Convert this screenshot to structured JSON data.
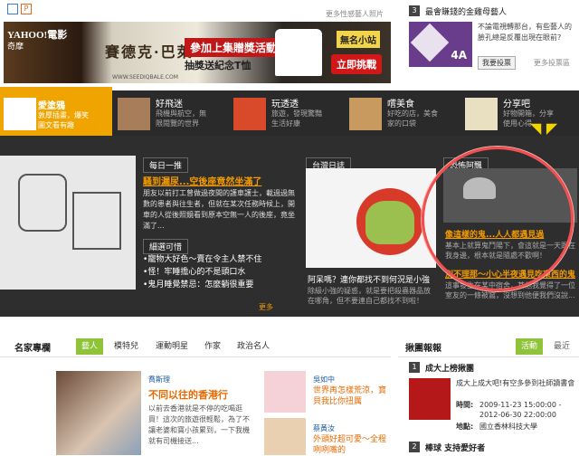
{
  "top": {
    "left_label": "P",
    "more_link": "更多性感藝人照片",
    "rank_number": "3",
    "rank_title": "最會賺錢的金雞母藝人"
  },
  "ad": {
    "brand": "YAHOO!電影",
    "brand_sub": "奇摩",
    "movie_title": "賽德克·巴萊",
    "headline": "參加上集贈獎活動",
    "subline": "抽獎送紀念T恤",
    "shop_badge": "無名小站",
    "cta": "立即挑戰",
    "fine_print": "WWW.SEEDIQBALE.COM"
  },
  "sidebar_top": {
    "logo_text": "4A",
    "desc": "不論電視轉那台，有些藝人的臉孔總是反覆出現在眼前?",
    "vote_button": "我要投票",
    "more": "更多投票區"
  },
  "nav": [
    {
      "title": "愛塗鴉",
      "sub": "敦厚插畫，爆笑圖文看有趣"
    },
    {
      "title": "好飛迷",
      "sub": "飛機與航空，無限閱覽的世界"
    },
    {
      "title": "玩透透",
      "sub": "旅遊，發現驚豔生活好康"
    },
    {
      "title": "嚐美食",
      "sub": "好吃的店，美食家的口袋"
    },
    {
      "title": "分享吧",
      "sub": "好物開箱，分享使用心得"
    }
  ],
  "main": {
    "daily_tag": "每日一推",
    "daily_headline": "騷到漏尿...空後座竟然坐滿了",
    "daily_body": "朋友以前打工曾做過夜間的護車護士，載過過無數的患者與往生者，但就在某次任務時候上，開車的人從後照鏡看到原本空無一人的後座，竟坐滿了...",
    "more_tag": "細選可惜",
    "list": [
      "寵物大好色～賣在令主人禁不住",
      "怪！牢睡擔心的不是頭口水",
      "鬼月睡覺禁忌：怎麼躺很重要"
    ],
    "more": "更多",
    "diary_tag": "台灣日誌",
    "diary_caption": "阿呆嗎？連你都找不到何況是小強",
    "diary_body": "除級小強的疑惑，就是要把殺蟲器品放在哪角，但不要連自己都找不到啦！",
    "scary_tag": "恐怖阿飄",
    "scary_headline": "像這樣的鬼...人人都遇見過",
    "scary_body": "基本上就算鬼鬥陽下，會這就是一天跟在我身邊，根本就是隨處不歡啊！",
    "scary_headline2": "別不理那～小心半夜遇見吃東西的鬼",
    "scary_body2": "這事發生在某中宿舍，其他我覺得了一位室友的一條被窩，沒想到他便我們沒說..."
  },
  "bottom": {
    "section_title": "名家專欄",
    "tabs": [
      "藝人",
      "模特兒",
      "運動明星",
      "作家",
      "政治名人"
    ],
    "author": "喬斯理",
    "article_title": "不同以往的香港行",
    "article_body": "以前去香港就是不停的吃喝逛買！這次的旅遊很輕鬆，為了不讓老婆和寶小孩累到，一下我機就有司機接送...",
    "side1_name": "吳如中",
    "side1_title": "世界再怎樣荒涼，寶貝我比你扭厲",
    "side2_name": "蔡黃汝",
    "side2_title": "外頭好超可愛～全程咧咧嘴的",
    "right_title": "揪團報報",
    "right_tab_active": "活動",
    "right_tab": "最近",
    "right_item1_num": "1",
    "right_item1_title": "成大上榜揪團",
    "right_item1_desc": "成大上成大吧!有空多參到社師讀書會",
    "time_label": "時間:",
    "time_value": "2009-11-23 15:00:00 - 2012-06-30 22:00:00",
    "place_label": "地點:",
    "place_value": "國立香林科技大學",
    "right_item2_num": "2",
    "right_item2_title": "棒球 支持愛好者"
  }
}
